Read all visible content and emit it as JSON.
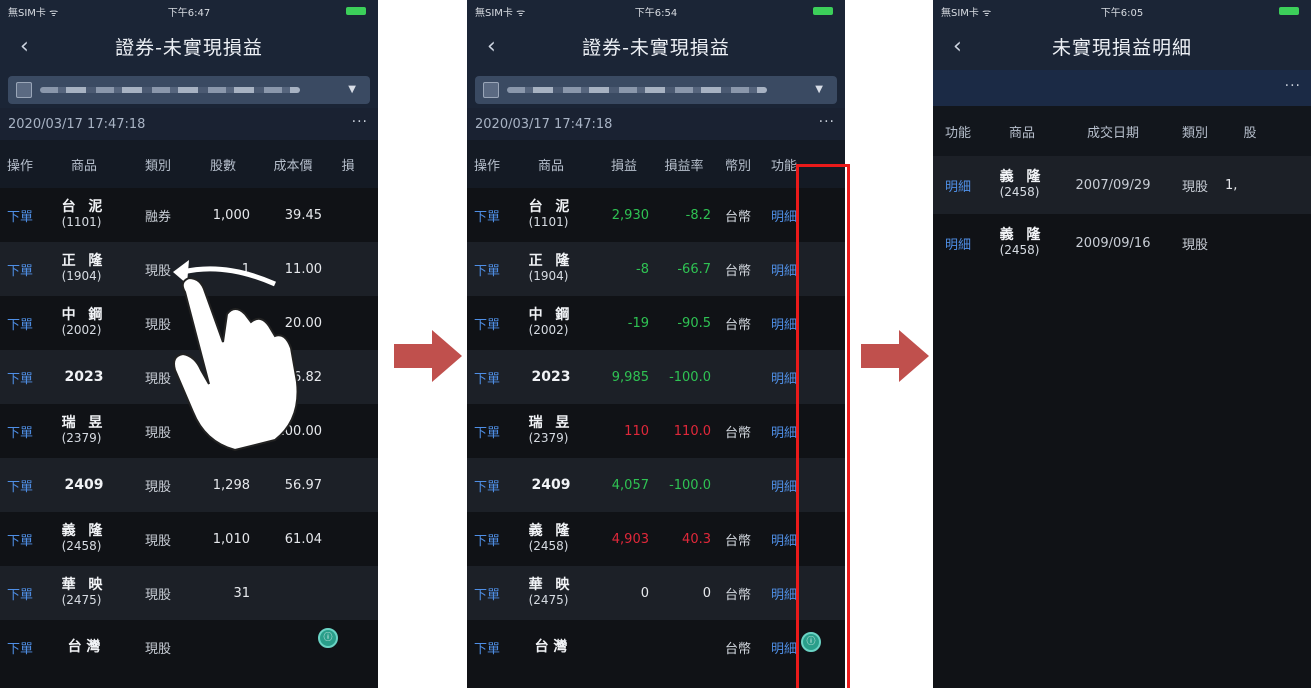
{
  "screen1": {
    "status": {
      "carrier": "無SIM卡 ᯤ",
      "time": "下午6:47"
    },
    "title": "證券-未實現損益",
    "date": "2020/03/17 17:47:18",
    "more": "···",
    "headers": [
      "操作",
      "商品",
      "類別",
      "股數",
      "成本價",
      "損"
    ],
    "rows": [
      {
        "action": "下單",
        "name": "台 泥",
        "code": "(1101)",
        "type": "融券",
        "qty": "1,000",
        "cost": "39.45"
      },
      {
        "action": "下單",
        "name": "正 隆",
        "code": "(1904)",
        "type": "現股",
        "qty": "1",
        "cost": "11.00"
      },
      {
        "action": "下單",
        "name": "中 鋼",
        "code": "(2002)",
        "type": "現股",
        "qty": "",
        "cost": "20.00"
      },
      {
        "action": "下單",
        "name": "2023",
        "code": "",
        "type": "現股",
        "qty": "",
        "cost": "16.82"
      },
      {
        "action": "下單",
        "name": "瑞 昱",
        "code": "(2379)",
        "type": "現股",
        "qty": "1",
        "cost": "100.00"
      },
      {
        "action": "下單",
        "name": "2409",
        "code": "",
        "type": "現股",
        "qty": "1,298",
        "cost": "56.97"
      },
      {
        "action": "下單",
        "name": "義 隆",
        "code": "(2458)",
        "type": "現股",
        "qty": "1,010",
        "cost": "61.04"
      },
      {
        "action": "下單",
        "name": "華 映",
        "code": "(2475)",
        "type": "現股",
        "qty": "31",
        "cost": ""
      },
      {
        "action": "下單",
        "name": "台 灣",
        "code": "",
        "type": "現股",
        "qty": "",
        "cost": ""
      }
    ]
  },
  "screen2": {
    "status": {
      "carrier": "無SIM卡 ᯤ",
      "time": "下午6:54"
    },
    "title": "證券-未實現損益",
    "date": "2020/03/17 17:47:18",
    "more": "···",
    "headers": [
      "操作",
      "商品",
      "損益",
      "損益率",
      "幣別",
      "功能"
    ],
    "rows": [
      {
        "action": "下單",
        "name": "台 泥",
        "code": "(1101)",
        "pl": "2,930",
        "rate": "-8.2",
        "cur": "台幣",
        "fn": "明細",
        "plc": "green",
        "ratec": "green"
      },
      {
        "action": "下單",
        "name": "正 隆",
        "code": "(1904)",
        "pl": "-8",
        "rate": "-66.7",
        "cur": "台幣",
        "fn": "明細",
        "plc": "green",
        "ratec": "green"
      },
      {
        "action": "下單",
        "name": "中 鋼",
        "code": "(2002)",
        "pl": "-19",
        "rate": "-90.5",
        "cur": "台幣",
        "fn": "明細",
        "plc": "green",
        "ratec": "green"
      },
      {
        "action": "下單",
        "name": "2023",
        "code": "",
        "pl": "9,985",
        "rate": "-100.0",
        "cur": "",
        "fn": "明細",
        "plc": "green",
        "ratec": "green"
      },
      {
        "action": "下單",
        "name": "瑞 昱",
        "code": "(2379)",
        "pl": "110",
        "rate": "110.0",
        "cur": "台幣",
        "fn": "明細",
        "plc": "red",
        "ratec": "red"
      },
      {
        "action": "下單",
        "name": "2409",
        "code": "",
        "pl": "4,057",
        "rate": "-100.0",
        "cur": "",
        "fn": "明細",
        "plc": "green",
        "ratec": "green"
      },
      {
        "action": "下單",
        "name": "義 隆",
        "code": "(2458)",
        "pl": "4,903",
        "rate": "40.3",
        "cur": "台幣",
        "fn": "明細",
        "plc": "red",
        "ratec": "red"
      },
      {
        "action": "下單",
        "name": "華 映",
        "code": "(2475)",
        "pl": "0",
        "rate": "0",
        "cur": "台幣",
        "fn": "明細",
        "plc": "white",
        "ratec": "white"
      },
      {
        "action": "下單",
        "name": "台 灣",
        "code": "",
        "pl": "",
        "rate": "",
        "cur": "台幣",
        "fn": "明細",
        "plc": "green",
        "ratec": "green"
      }
    ]
  },
  "screen3": {
    "status": {
      "carrier": "無SIM卡 ᯤ",
      "time": "下午6:05"
    },
    "title": "未實現損益明細",
    "more": "···",
    "headers": [
      "功能",
      "商品",
      "成交日期",
      "類別",
      "股"
    ],
    "rows": [
      {
        "fn": "明細",
        "name": "義 隆",
        "code": "(2458)",
        "date": "2007/09/29",
        "type": "現股",
        "qty": "1,"
      },
      {
        "fn": "明細",
        "name": "義 隆",
        "code": "(2458)",
        "date": "2009/09/16",
        "type": "現股",
        "qty": ""
      }
    ]
  },
  "colors": {
    "arrow": "#c0504d",
    "highlight": "#ea1a1a",
    "gain": "#e0283a",
    "loss": "#2fc253",
    "link": "#4f8fe6"
  },
  "icons": {
    "back": "chevron-left-icon",
    "swipe": "swipe-hand-icon",
    "next": "right-arrow-icon"
  }
}
